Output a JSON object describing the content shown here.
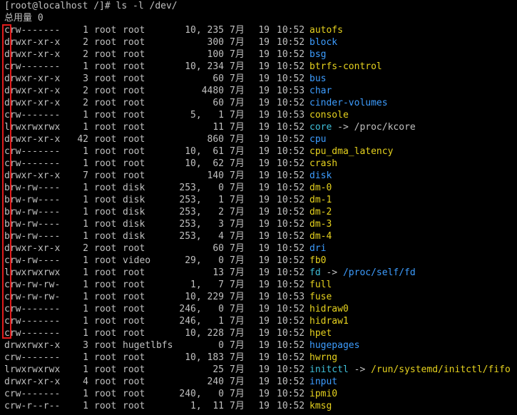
{
  "terminal": {
    "prompt": "[root@localhost /]# ls -l /dev/",
    "total": "总用量 0",
    "colors": {
      "text": "#c0c0c0",
      "char_device": "#e6d21e",
      "directory": "#3d9dff",
      "symlink": "#3fbfd9",
      "symlink_target_dir": "#3d9dff",
      "symlink_target_char": "#e6d21e",
      "highlight_box": "#e21b1b"
    },
    "entries": [
      {
        "perm": "crw-------",
        "links": "1",
        "owner": "root",
        "group": "root",
        "size": "10, 235",
        "month": "7月",
        "day": "19",
        "time": "10:52",
        "name": "autofs",
        "type": "char"
      },
      {
        "perm": "drwxr-xr-x",
        "links": "2",
        "owner": "root",
        "group": "root",
        "size": "300",
        "month": "7月",
        "day": "19",
        "time": "10:52",
        "name": "block",
        "type": "dir"
      },
      {
        "perm": "drwxr-xr-x",
        "links": "2",
        "owner": "root",
        "group": "root",
        "size": "100",
        "month": "7月",
        "day": "19",
        "time": "10:52",
        "name": "bsg",
        "type": "dir"
      },
      {
        "perm": "crw-------",
        "links": "1",
        "owner": "root",
        "group": "root",
        "size": "10, 234",
        "month": "7月",
        "day": "19",
        "time": "10:52",
        "name": "btrfs-control",
        "type": "char"
      },
      {
        "perm": "drwxr-xr-x",
        "links": "3",
        "owner": "root",
        "group": "root",
        "size": "60",
        "month": "7月",
        "day": "19",
        "time": "10:52",
        "name": "bus",
        "type": "dir"
      },
      {
        "perm": "drwxr-xr-x",
        "links": "2",
        "owner": "root",
        "group": "root",
        "size": "4480",
        "month": "7月",
        "day": "19",
        "time": "10:53",
        "name": "char",
        "type": "dir"
      },
      {
        "perm": "drwxr-xr-x",
        "links": "2",
        "owner": "root",
        "group": "root",
        "size": "60",
        "month": "7月",
        "day": "19",
        "time": "10:52",
        "name": "cinder-volumes",
        "type": "dir"
      },
      {
        "perm": "crw-------",
        "links": "1",
        "owner": "root",
        "group": "root",
        "size": "5,   1",
        "month": "7月",
        "day": "19",
        "time": "10:53",
        "name": "console",
        "type": "char"
      },
      {
        "perm": "lrwxrwxrwx",
        "links": "1",
        "owner": "root",
        "group": "root",
        "size": "11",
        "month": "7月",
        "day": "19",
        "time": "10:52",
        "name": "core",
        "type": "link",
        "target": "/proc/kcore",
        "target_type": "plain"
      },
      {
        "perm": "drwxr-xr-x",
        "links": "42",
        "owner": "root",
        "group": "root",
        "size": "860",
        "month": "7月",
        "day": "19",
        "time": "10:52",
        "name": "cpu",
        "type": "dir"
      },
      {
        "perm": "crw-------",
        "links": "1",
        "owner": "root",
        "group": "root",
        "size": "10,  61",
        "month": "7月",
        "day": "19",
        "time": "10:52",
        "name": "cpu_dma_latency",
        "type": "char"
      },
      {
        "perm": "crw-------",
        "links": "1",
        "owner": "root",
        "group": "root",
        "size": "10,  62",
        "month": "7月",
        "day": "19",
        "time": "10:52",
        "name": "crash",
        "type": "char"
      },
      {
        "perm": "drwxr-xr-x",
        "links": "7",
        "owner": "root",
        "group": "root",
        "size": "140",
        "month": "7月",
        "day": "19",
        "time": "10:52",
        "name": "disk",
        "type": "dir"
      },
      {
        "perm": "brw-rw----",
        "links": "1",
        "owner": "root",
        "group": "disk",
        "size": "253,   0",
        "month": "7月",
        "day": "19",
        "time": "10:52",
        "name": "dm-0",
        "type": "char"
      },
      {
        "perm": "brw-rw----",
        "links": "1",
        "owner": "root",
        "group": "disk",
        "size": "253,   1",
        "month": "7月",
        "day": "19",
        "time": "10:52",
        "name": "dm-1",
        "type": "char"
      },
      {
        "perm": "brw-rw----",
        "links": "1",
        "owner": "root",
        "group": "disk",
        "size": "253,   2",
        "month": "7月",
        "day": "19",
        "time": "10:52",
        "name": "dm-2",
        "type": "char"
      },
      {
        "perm": "brw-rw----",
        "links": "1",
        "owner": "root",
        "group": "disk",
        "size": "253,   3",
        "month": "7月",
        "day": "19",
        "time": "10:52",
        "name": "dm-3",
        "type": "char"
      },
      {
        "perm": "brw-rw----",
        "links": "1",
        "owner": "root",
        "group": "disk",
        "size": "253,   4",
        "month": "7月",
        "day": "19",
        "time": "10:52",
        "name": "dm-4",
        "type": "char"
      },
      {
        "perm": "drwxr-xr-x",
        "links": "2",
        "owner": "root",
        "group": "root",
        "size": "60",
        "month": "7月",
        "day": "19",
        "time": "10:52",
        "name": "dri",
        "type": "dir"
      },
      {
        "perm": "crw-rw----",
        "links": "1",
        "owner": "root",
        "group": "video",
        "size": "29,   0",
        "month": "7月",
        "day": "19",
        "time": "10:52",
        "name": "fb0",
        "type": "char"
      },
      {
        "perm": "lrwxrwxrwx",
        "links": "1",
        "owner": "root",
        "group": "root",
        "size": "13",
        "month": "7月",
        "day": "19",
        "time": "10:52",
        "name": "fd",
        "type": "link",
        "target": "/proc/self/fd",
        "target_type": "dir"
      },
      {
        "perm": "crw-rw-rw-",
        "links": "1",
        "owner": "root",
        "group": "root",
        "size": "1,   7",
        "month": "7月",
        "day": "19",
        "time": "10:52",
        "name": "full",
        "type": "char"
      },
      {
        "perm": "crw-rw-rw-",
        "links": "1",
        "owner": "root",
        "group": "root",
        "size": "10, 229",
        "month": "7月",
        "day": "19",
        "time": "10:53",
        "name": "fuse",
        "type": "char"
      },
      {
        "perm": "crw-------",
        "links": "1",
        "owner": "root",
        "group": "root",
        "size": "246,   0",
        "month": "7月",
        "day": "19",
        "time": "10:52",
        "name": "hidraw0",
        "type": "char"
      },
      {
        "perm": "crw-------",
        "links": "1",
        "owner": "root",
        "group": "root",
        "size": "246,   1",
        "month": "7月",
        "day": "19",
        "time": "10:52",
        "name": "hidraw1",
        "type": "char"
      },
      {
        "perm": "crw-------",
        "links": "1",
        "owner": "root",
        "group": "root",
        "size": "10, 228",
        "month": "7月",
        "day": "19",
        "time": "10:52",
        "name": "hpet",
        "type": "char"
      },
      {
        "perm": "drwxrwxr-x",
        "links": "3",
        "owner": "root",
        "group": "hugetlbfs",
        "size": "0",
        "month": "7月",
        "day": "19",
        "time": "10:52",
        "name": "hugepages",
        "type": "dir"
      },
      {
        "perm": "crw-------",
        "links": "1",
        "owner": "root",
        "group": "root",
        "size": "10, 183",
        "month": "7月",
        "day": "19",
        "time": "10:52",
        "name": "hwrng",
        "type": "char"
      },
      {
        "perm": "lrwxrwxrwx",
        "links": "1",
        "owner": "root",
        "group": "root",
        "size": "25",
        "month": "7月",
        "day": "19",
        "time": "10:52",
        "name": "initctl",
        "type": "link",
        "target": "/run/systemd/initctl/fifo",
        "target_type": "fifo"
      },
      {
        "perm": "drwxr-xr-x",
        "links": "4",
        "owner": "root",
        "group": "root",
        "size": "240",
        "month": "7月",
        "day": "19",
        "time": "10:52",
        "name": "input",
        "type": "dir"
      },
      {
        "perm": "crw-------",
        "links": "1",
        "owner": "root",
        "group": "root",
        "size": "240,   0",
        "month": "7月",
        "day": "19",
        "time": "10:52",
        "name": "ipmi0",
        "type": "char"
      },
      {
        "perm": "crw-r--r--",
        "links": "1",
        "owner": "root",
        "group": "root",
        "size": "1,  11",
        "month": "7月",
        "day": "19",
        "time": "10:52",
        "name": "kmsg",
        "type": "char"
      }
    ]
  }
}
